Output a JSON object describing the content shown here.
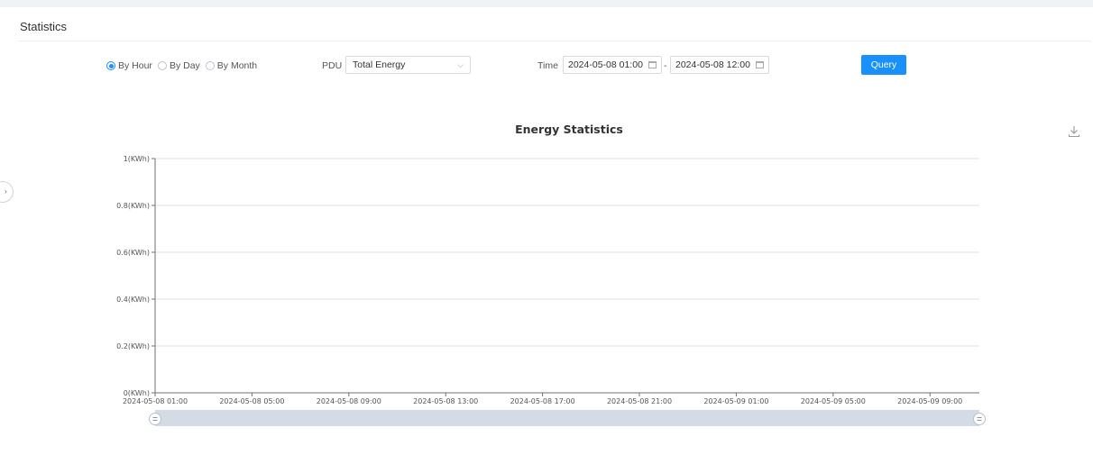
{
  "panel": {
    "title": "Statistics"
  },
  "filters": {
    "granularity": [
      {
        "label": "By Hour",
        "checked": true
      },
      {
        "label": "By Day",
        "checked": false
      },
      {
        "label": "By Month",
        "checked": false
      }
    ],
    "pdu_label": "PDU",
    "pdu_value": "Total Energy",
    "time_label": "Time",
    "start_time": "2024-05-08 01:00",
    "separator": "-",
    "end_time": "2024-05-08 12:00",
    "query_label": "Query"
  },
  "icons": {
    "download": "download-icon",
    "calendar": "calendar-icon",
    "select_arrow": "chevron-down-icon",
    "sidebar_toggle": "chevron-right-icon"
  },
  "colors": {
    "accent": "#1890ff",
    "gridline": "#e0e0e0",
    "axis": "#6e7079",
    "slider_fill": "#d3dbe6"
  },
  "chart_data": {
    "type": "line",
    "title": "Energy Statistics",
    "x": [
      "2024-05-08 01:00",
      "2024-05-08 05:00",
      "2024-05-08 09:00",
      "2024-05-08 13:00",
      "2024-05-08 17:00",
      "2024-05-08 21:00",
      "2024-05-09 01:00",
      "2024-05-09 05:00",
      "2024-05-09 09:00"
    ],
    "y_ticks": [
      "0(KWh)",
      "0.2(KWh)",
      "0.4(KWh)",
      "0.6(KWh)",
      "0.8(KWh)",
      "1(KWh)"
    ],
    "ylim": [
      0,
      1
    ],
    "series": [],
    "grid": true,
    "zoom_range": [
      0,
      100
    ]
  }
}
